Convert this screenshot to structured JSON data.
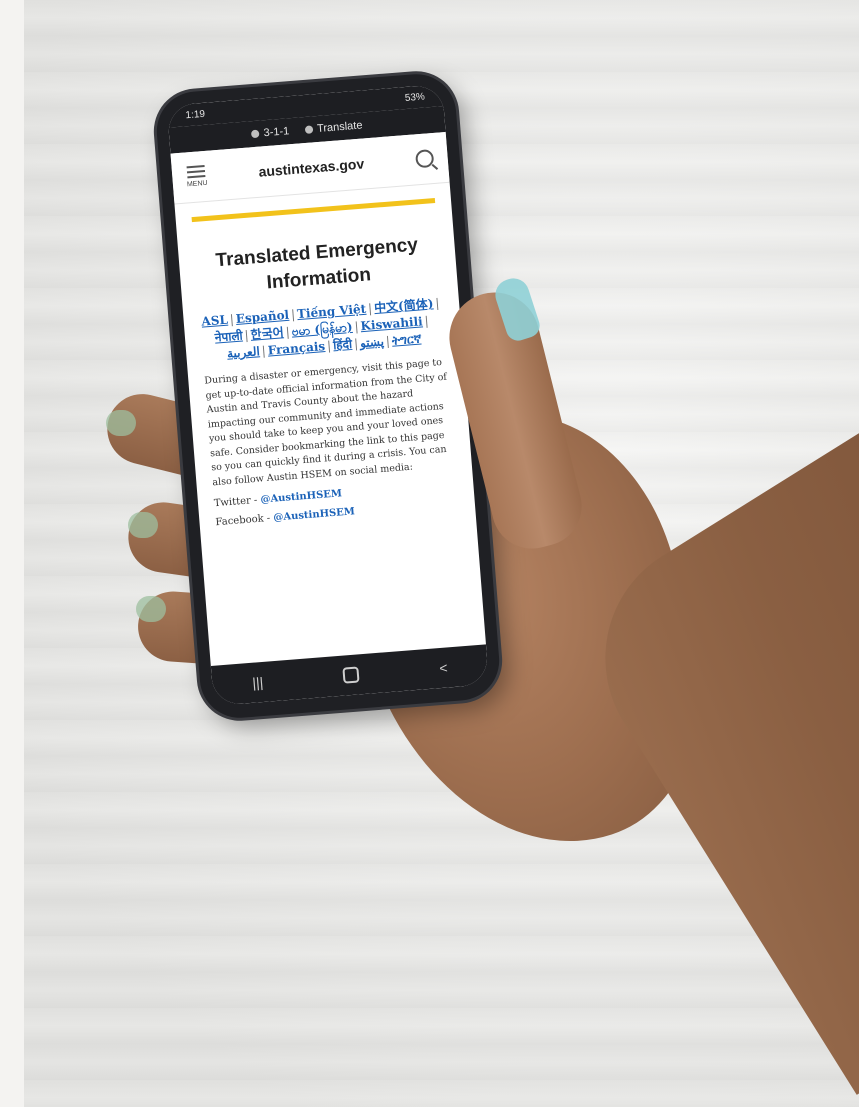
{
  "status": {
    "time": "1:19",
    "indicators": "53%"
  },
  "translate_bar": {
    "info_label": "3-1-1",
    "translate_label": "Translate"
  },
  "site": {
    "menu_label": "MENU",
    "domain": "austintexas.gov"
  },
  "page": {
    "title": "Translated Emergency Information",
    "languages": [
      "ASL",
      "Español",
      "Tiếng Việt",
      "中文(简体)",
      "नेपाली",
      "한국어",
      "ဗမာ (မြန်မာ)",
      "Kiswahili",
      "العربية",
      "Français",
      "हिंदी",
      "پښتو",
      "ትግርኛ"
    ],
    "body": "During a disaster or emergency, visit this page to get up-to-date official information from the City of Austin and Travis County about the hazard impacting our community and immediate actions you should take to keep you and your loved ones safe. Consider bookmarking the link to this page so you can quickly find it during a crisis. You can also follow Austin HSEM on social media:",
    "twitter_label": "Twitter -",
    "twitter_handle": "@AustinHSEM",
    "facebook_label": "Facebook -",
    "facebook_handle": "@AustinHSEM"
  },
  "navbar": {
    "recents": "|||",
    "back": "<"
  }
}
